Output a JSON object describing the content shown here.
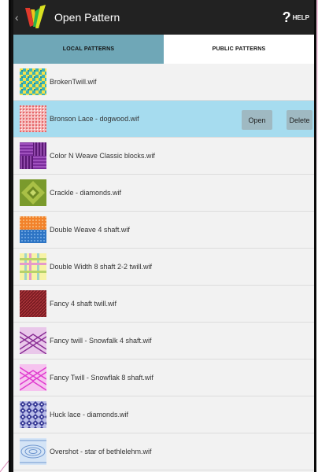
{
  "app": {
    "title": "Open Pattern",
    "help_label": "HELP"
  },
  "tabs": [
    {
      "label": "LOCAL PATTERNS",
      "active": true
    },
    {
      "label": "PUBLIC PATTERNS",
      "active": false
    }
  ],
  "selected_actions": {
    "open_label": "Open",
    "delete_label": "Delete"
  },
  "patterns": [
    {
      "name": "BrokenTwill.wif",
      "thumb": "broken-twill",
      "selected": false
    },
    {
      "name": "Bronson Lace - dogwood.wif",
      "thumb": "bronson-lace",
      "selected": true
    },
    {
      "name": "Color N Weave Classic blocks.wif",
      "thumb": "color-n-weave",
      "selected": false
    },
    {
      "name": "Crackle - diamonds.wif",
      "thumb": "crackle",
      "selected": false
    },
    {
      "name": "Double Weave 4 shaft.wif",
      "thumb": "double-weave",
      "selected": false
    },
    {
      "name": "Double Width 8 shaft 2-2 twill.wif",
      "thumb": "double-width",
      "selected": false
    },
    {
      "name": "Fancy 4 shaft twill.wif",
      "thumb": "fancy-twill",
      "selected": false
    },
    {
      "name": "Fancy twill - Snowfalk 4 shaft.wif",
      "thumb": "snowfalk",
      "selected": false
    },
    {
      "name": "Fancy Twill - Snowflak 8 shaft.wif",
      "thumb": "snowflak",
      "selected": false
    },
    {
      "name": "Huck lace - diamonds.wif",
      "thumb": "huck-lace",
      "selected": false
    },
    {
      "name": "Overshot - star of bethlelehm.wif",
      "thumb": "overshot",
      "selected": false
    }
  ],
  "colors": {
    "action_bar": "#222222",
    "tab_active": "#6fa7b7",
    "row_selected": "#a6dcef",
    "button": "#9fb9c2"
  }
}
